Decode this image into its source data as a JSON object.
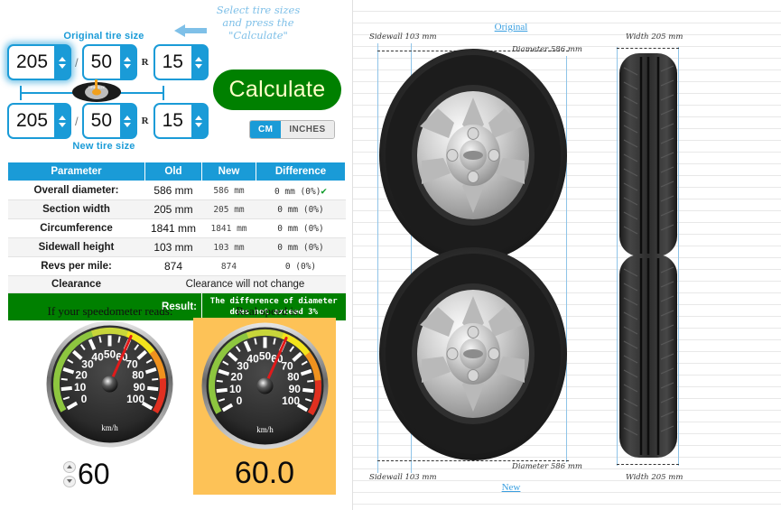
{
  "annotation": {
    "line1": "Select tire sizes",
    "line2": "and press the",
    "line3": "\"Calculate\"",
    "arrow_icon": "arrow-left-icon"
  },
  "selectors": {
    "original_label": "Original tire size",
    "new_label": "New tire size",
    "separator_slash": "/",
    "separator_r": "R",
    "original": {
      "width": "205",
      "aspect": "50",
      "rim": "15"
    },
    "new": {
      "width": "205",
      "aspect": "50",
      "rim": "15"
    }
  },
  "calculate_button": {
    "label": "Calculate"
  },
  "unit_toggle": {
    "cm": "CM",
    "inches": "INCHES",
    "selected": "CM"
  },
  "table": {
    "headers": [
      "Parameter",
      "Old",
      "New",
      "Difference"
    ],
    "rows": [
      {
        "parameter": "Overall diameter:",
        "old": "586 mm",
        "new": "586 mm",
        "difference": "0 mm (0%)",
        "ok": true
      },
      {
        "parameter": "Section width",
        "old": "205 mm",
        "new": "205 mm",
        "difference": "0 mm (0%)",
        "ok": false
      },
      {
        "parameter": "Circumference",
        "old": "1841 mm",
        "new": "1841 mm",
        "difference": "0 mm (0%)",
        "ok": false
      },
      {
        "parameter": "Sidewall height",
        "old": "103 mm",
        "new": "103 mm",
        "difference": "0 mm (0%)",
        "ok": false
      },
      {
        "parameter": "Revs per mile:",
        "old": "874",
        "new": "874",
        "difference": "0 (0%)",
        "ok": false
      }
    ],
    "clearance_label": "Clearance",
    "clearance_value": "Clearance will not change",
    "result_label": "Result:",
    "result_text": "The difference of diameter does not exceed 3%"
  },
  "speedometers": {
    "left_heading": "If your speedometer reads:",
    "right_heading": "Real speed is:",
    "unit": "km/h",
    "input_value": "60",
    "real_value": "60.0",
    "scale_ticks": [
      "0",
      "10",
      "20",
      "30",
      "40",
      "50",
      "60",
      "70",
      "80",
      "90",
      "100"
    ],
    "left_needle": 60,
    "right_needle": 60,
    "max": 100
  },
  "diagram": {
    "original_caption": "Original",
    "new_caption": "New",
    "original": {
      "sidewall": "Sidewall 103 mm",
      "diameter": "Diameter 586 mm",
      "width": "Width 205 mm"
    },
    "new": {
      "sidewall": "Sidewall 103 mm",
      "diameter": "Diameter 586 mm",
      "width": "Width 205 mm"
    }
  },
  "colors": {
    "accent_blue": "#1a9bd7",
    "result_green": "#008000",
    "highlight_orange": "#fdc257",
    "caption_blue": "#3a9fe0"
  }
}
